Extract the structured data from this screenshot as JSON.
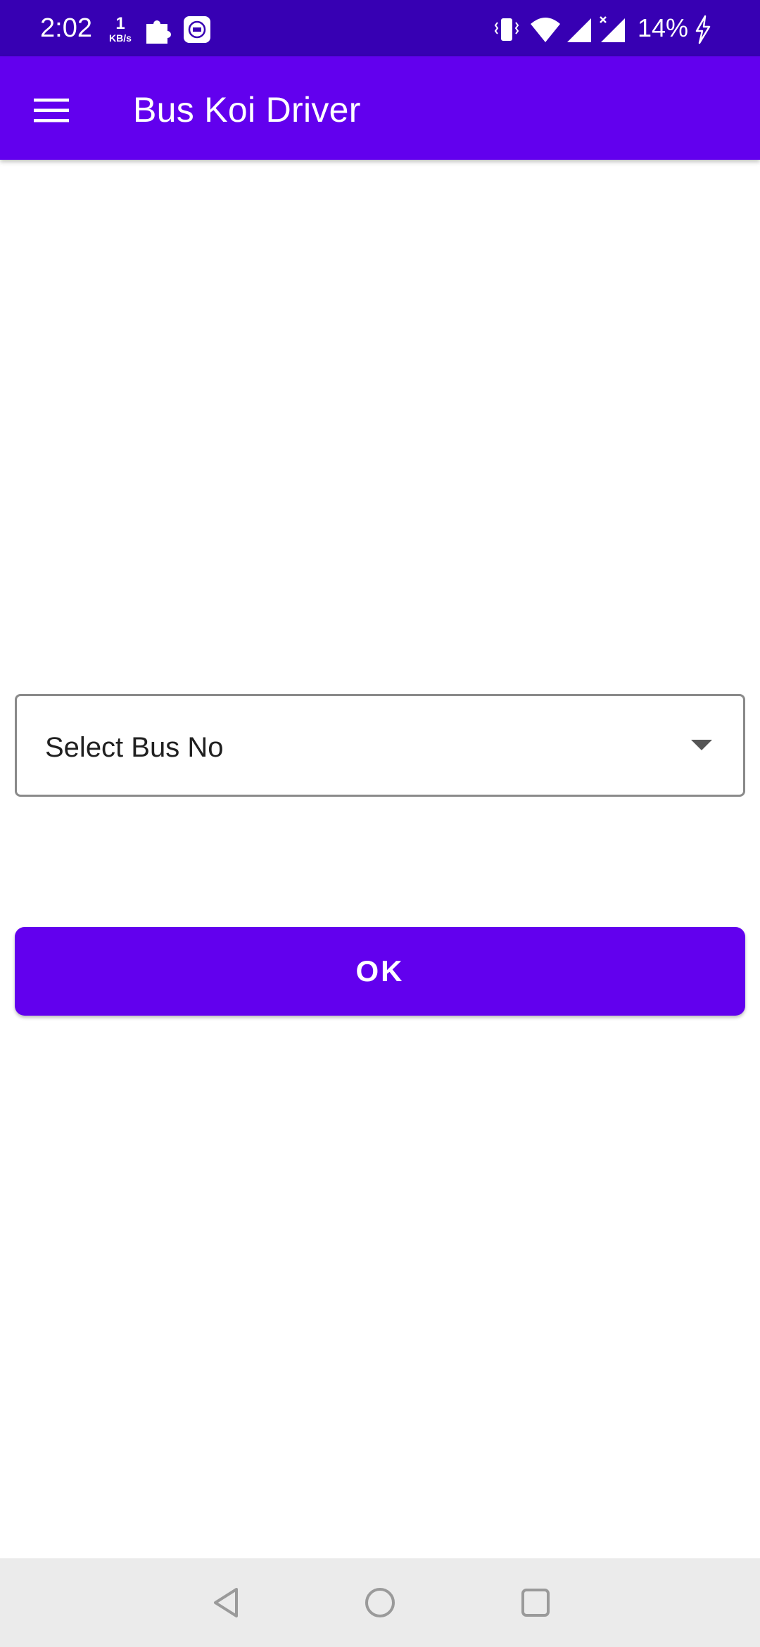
{
  "status_bar": {
    "time": "2:02",
    "net_speed_value": "1",
    "net_speed_unit": "KB/s",
    "battery": "14%",
    "background_color": "#3700b3",
    "icons": [
      "puzzle-icon",
      "mi-app-icon",
      "vibrate-icon",
      "wifi-icon",
      "signal-icon",
      "signal-no-data-icon",
      "charging-icon"
    ]
  },
  "app_bar": {
    "title": "Bus Koi Driver",
    "menu_icon": "hamburger-menu-icon",
    "background_color": "#6200ee"
  },
  "form": {
    "bus_select": {
      "selected_value": "Select Bus No",
      "icon": "dropdown-arrow-icon"
    },
    "ok_button_label": "OK"
  },
  "navigation_bar": {
    "buttons": [
      "back-icon",
      "home-icon",
      "recents-icon"
    ]
  }
}
